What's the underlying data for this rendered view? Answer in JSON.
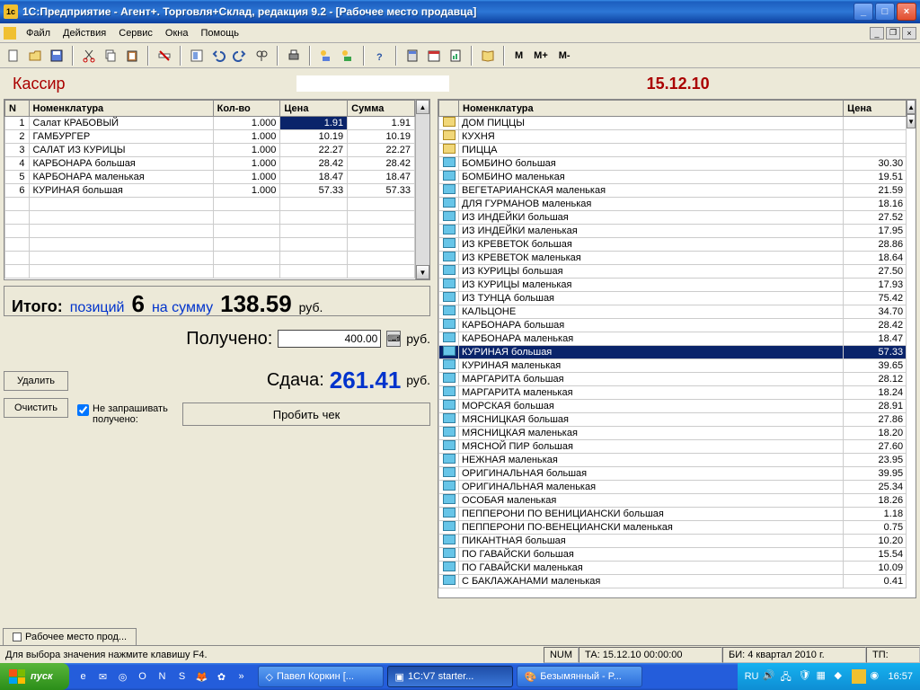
{
  "window": {
    "title": "1С:Предприятие - Агент+. Торговля+Склад, редакция 9.2 - [Рабочее место продавца]"
  },
  "menu": {
    "file": "Файл",
    "actions": "Действия",
    "service": "Сервис",
    "windows": "Окна",
    "help": "Помощь"
  },
  "toolbar_m": {
    "m": "М",
    "mplus": "М+",
    "mminus": "М-"
  },
  "header": {
    "cashier": "Кассир",
    "date": "15.12.10"
  },
  "receipt": {
    "columns": {
      "n": "N",
      "name": "Номенклатура",
      "qty": "Кол-во",
      "price": "Цена",
      "sum": "Сумма"
    },
    "rows": [
      {
        "n": 1,
        "name": "Салат КРАБОВЫЙ",
        "qty": "1.000",
        "price": "1.91",
        "sum": "1.91"
      },
      {
        "n": 2,
        "name": "ГАМБУРГЕР",
        "qty": "1.000",
        "price": "10.19",
        "sum": "10.19"
      },
      {
        "n": 3,
        "name": "САЛАТ ИЗ КУРИЦЫ",
        "qty": "1.000",
        "price": "22.27",
        "sum": "22.27"
      },
      {
        "n": 4,
        "name": "КАРБОНАРА большая",
        "qty": "1.000",
        "price": "28.42",
        "sum": "28.42"
      },
      {
        "n": 5,
        "name": "КАРБОНАРА маленькая",
        "qty": "1.000",
        "price": "18.47",
        "sum": "18.47"
      },
      {
        "n": 6,
        "name": "КУРИНАЯ большая",
        "qty": "1.000",
        "price": "57.33",
        "sum": "57.33"
      }
    ]
  },
  "totals": {
    "itogo": "Итого:",
    "poz_lbl": "позиций",
    "poz_val": "6",
    "sum_lbl": "на сумму",
    "total": "138.59",
    "rub": "руб.",
    "received_lbl": "Получено:",
    "received_val": "400.00",
    "change_lbl": "Сдача:",
    "change_val": "261.41"
  },
  "buttons": {
    "delete": "Удалить",
    "clear": "Очистить",
    "check": "Пробить чек",
    "noask": "Не запрашивать получено:"
  },
  "catalog": {
    "columns": {
      "name": "Номенклатура",
      "price": "Цена"
    },
    "rows": [
      {
        "t": "y",
        "name": "ДОМ ПИЦЦЫ",
        "price": ""
      },
      {
        "t": "y",
        "name": "КУХНЯ",
        "price": ""
      },
      {
        "t": "y",
        "name": "ПИЦЦА",
        "price": ""
      },
      {
        "t": "b",
        "name": "БОМБИНО большая",
        "price": "30.30"
      },
      {
        "t": "b",
        "name": "БОМБИНО маленькая",
        "price": "19.51"
      },
      {
        "t": "b",
        "name": "ВЕГЕТАРИАНСКАЯ маленькая",
        "price": "21.59"
      },
      {
        "t": "b",
        "name": "ДЛЯ ГУРМАНОВ маленькая",
        "price": "18.16"
      },
      {
        "t": "b",
        "name": "ИЗ ИНДЕЙКИ большая",
        "price": "27.52"
      },
      {
        "t": "b",
        "name": "ИЗ ИНДЕЙКИ маленькая",
        "price": "17.95"
      },
      {
        "t": "b",
        "name": "ИЗ КРЕВЕТОК большая",
        "price": "28.86"
      },
      {
        "t": "b",
        "name": "ИЗ КРЕВЕТОК маленькая",
        "price": "18.64"
      },
      {
        "t": "b",
        "name": "ИЗ КУРИЦЫ большая",
        "price": "27.50"
      },
      {
        "t": "b",
        "name": "ИЗ КУРИЦЫ маленькая",
        "price": "17.93"
      },
      {
        "t": "b",
        "name": "ИЗ ТУНЦА большая",
        "price": "75.42"
      },
      {
        "t": "b",
        "name": "КАЛЬЦОНЕ",
        "price": "34.70"
      },
      {
        "t": "b",
        "name": "КАРБОНАРА большая",
        "price": "28.42"
      },
      {
        "t": "b",
        "name": "КАРБОНАРА маленькая",
        "price": "18.47"
      },
      {
        "t": "b",
        "name": "КУРИНАЯ большая",
        "price": "57.33",
        "sel": true
      },
      {
        "t": "b",
        "name": "КУРИНАЯ маленькая",
        "price": "39.65"
      },
      {
        "t": "b",
        "name": "МАРГАРИТА большая",
        "price": "28.12"
      },
      {
        "t": "b",
        "name": "МАРГАРИТА маленькая",
        "price": "18.24"
      },
      {
        "t": "b",
        "name": "МОРСКАЯ большая",
        "price": "28.91"
      },
      {
        "t": "b",
        "name": "МЯСНИЦКАЯ большая",
        "price": "27.86"
      },
      {
        "t": "b",
        "name": "МЯСНИЦКАЯ маленькая",
        "price": "18.20"
      },
      {
        "t": "b",
        "name": "МЯСНОЙ ПИР большая",
        "price": "27.60"
      },
      {
        "t": "b",
        "name": "НЕЖНАЯ маленькая",
        "price": "23.95"
      },
      {
        "t": "b",
        "name": "ОРИГИНАЛЬНАЯ большая",
        "price": "39.95"
      },
      {
        "t": "b",
        "name": "ОРИГИНАЛЬНАЯ маленькая",
        "price": "25.34"
      },
      {
        "t": "b",
        "name": "ОСОБАЯ маленькая",
        "price": "18.26"
      },
      {
        "t": "b",
        "name": "ПЕППЕРОНИ ПО ВЕНИЦИАНСКИ большая",
        "price": "1.18"
      },
      {
        "t": "b",
        "name": "ПЕППЕРОНИ ПО-ВЕНЕЦИАНСКИ маленькая",
        "price": "0.75"
      },
      {
        "t": "b",
        "name": "ПИКАНТНАЯ большая",
        "price": "10.20"
      },
      {
        "t": "b",
        "name": "ПО ГАВАЙСКИ большая",
        "price": "15.54"
      },
      {
        "t": "b",
        "name": "ПО ГАВАЙСКИ маленькая",
        "price": "10.09"
      },
      {
        "t": "b",
        "name": "С БАКЛАЖАНАМИ маленькая",
        "price": "0.41"
      }
    ]
  },
  "doctab": "Рабочее место прод...",
  "statusbar": {
    "hint": "Для выбора значения нажмите клавишу F4.",
    "num": "NUM",
    "ta": "ТА: 15.12.10  00:00:00",
    "bi": "БИ: 4 квартал 2010 г.",
    "tp": "ТП:"
  },
  "taskbar": {
    "start": "пуск",
    "tasks": [
      {
        "label": "Павел Коркин [..."
      },
      {
        "label": "1C:V7 starter..."
      },
      {
        "label": "Безымянный - P..."
      }
    ],
    "lang": "RU",
    "clock": "16:57"
  }
}
